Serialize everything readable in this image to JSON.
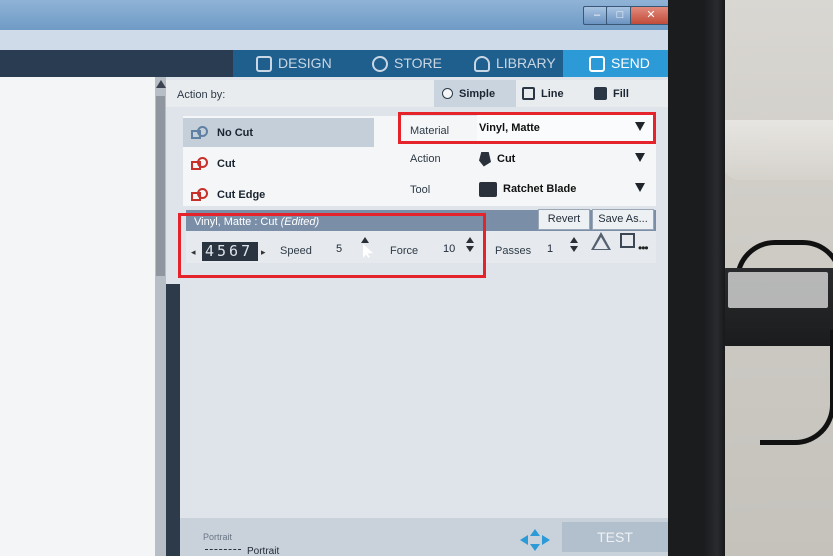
{
  "nav": {
    "design": "DESIGN",
    "store": "STORE",
    "library": "LIBRARY",
    "send": "SEND"
  },
  "action_bar": {
    "label": "Action by:",
    "simple": "Simple",
    "line": "Line",
    "fill": "Fill"
  },
  "cut_types": [
    "No Cut",
    "Cut",
    "Cut Edge"
  ],
  "settings": {
    "material_label": "Material",
    "material_value": "Vinyl, Matte",
    "action_label": "Action",
    "action_value": "Cut",
    "tool_label": "Tool",
    "tool_value": "Ratchet Blade"
  },
  "edit_bar": {
    "title": "Vinyl, Matte : Cut",
    "edited": "(Edited)",
    "revert": "Revert",
    "save_as": "Save As..."
  },
  "params": {
    "depth_digits": "4567",
    "speed_label": "Speed",
    "speed_value": "5",
    "force_label": "Force",
    "force_value": "10",
    "passes_label": "Passes",
    "passes_value": "1"
  },
  "bottom": {
    "orientation_label": "Portrait",
    "orientation_value": "Portrait",
    "test": "TEST"
  },
  "colors": {
    "send_tab": "#2c9ad6",
    "highlight": "#e4242a",
    "cut_icon": "#c8302a"
  }
}
